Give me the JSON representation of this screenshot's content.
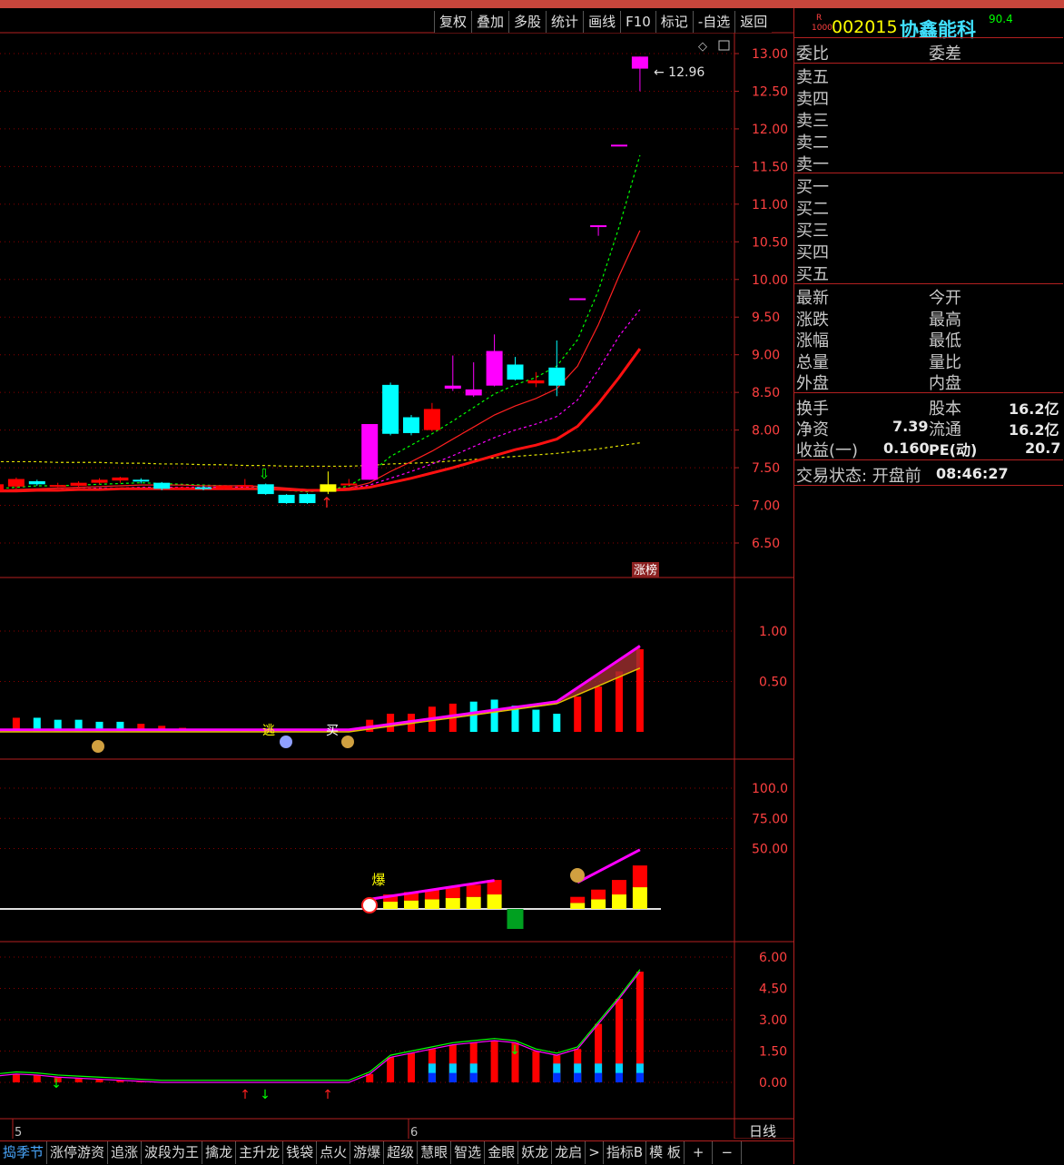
{
  "toolbar": [
    "复权",
    "叠加",
    "多股",
    "统计",
    "画线",
    "F10",
    "标记",
    "-自选",
    "返回"
  ],
  "stock": {
    "code": "002015",
    "name": "协鑫能科",
    "badge_top": "R",
    "badge_bottom": "1000",
    "score": "90.4"
  },
  "order_book": {
    "ratio_label": "委比",
    "diff_label": "委差",
    "sells": [
      "卖五",
      "卖四",
      "卖三",
      "卖二",
      "卖一"
    ],
    "buys": [
      "买一",
      "买二",
      "买三",
      "买四",
      "买五"
    ]
  },
  "stats_left": [
    "最新",
    "涨跌",
    "涨幅",
    "总量",
    "外盘"
  ],
  "stats_right": [
    "今开",
    "最高",
    "最低",
    "量比",
    "内盘"
  ],
  "fundamentals": [
    {
      "label": "换手",
      "label2": "股本",
      "value2": "16.2亿"
    },
    {
      "label": "净资",
      "value": "7.39",
      "label2": "流通",
      "value2": "16.2亿"
    },
    {
      "label": "收益(一)",
      "value": "0.160",
      "label2": "PE(动)",
      "value2": "20.7"
    }
  ],
  "trade_state": {
    "label": "交易状态: 开盘前",
    "time": "08:46:27"
  },
  "price_axis": [
    "13.00",
    "12.50",
    "12.00",
    "11.50",
    "11.00",
    "10.50",
    "10.00",
    "9.50",
    "9.00",
    "8.50",
    "8.00",
    "7.50",
    "7.00",
    "6.50"
  ],
  "price_max_label": "12.96",
  "zhangbang": "涨榜",
  "ind1_axis": [
    "1.00",
    "0.50"
  ],
  "ind2_axis": [
    "100.0",
    "75.00",
    "50.00"
  ],
  "ind3_axis": [
    "6.00",
    "4.50",
    "3.00",
    "1.50",
    "0.00"
  ],
  "markers": {
    "escape": "逃",
    "buy": "买",
    "explode": "爆"
  },
  "date_labels": [
    "5",
    "6"
  ],
  "period": "日线",
  "bottom_tabs": [
    "捣季节",
    "涨停游资",
    "追涨",
    "波段为王",
    "擒龙",
    "主升龙",
    "钱袋",
    "点火",
    "游爆",
    "超级",
    "慧眼",
    "智选",
    "金眼",
    "妖龙",
    "龙启",
    ">",
    "指标B",
    "模 板",
    "+",
    "−"
  ],
  "colors": {
    "up": "#ff0000",
    "down": "#00ffff",
    "magenta": "#ff00ff",
    "grid": "#8b0000",
    "border": "#b32020",
    "yellow": "#ffff00",
    "green": "#00ff00"
  },
  "chart_data": {
    "type": "candlestick",
    "candles": [
      {
        "o": 7.2,
        "c": 7.28,
        "h": 7.3,
        "l": 7.18
      },
      {
        "o": 7.25,
        "c": 7.35,
        "h": 7.37,
        "l": 7.22
      },
      {
        "o": 7.32,
        "c": 7.28,
        "h": 7.34,
        "l": 7.26
      },
      {
        "o": 7.27,
        "c": 7.27,
        "h": 7.3,
        "l": 7.24
      },
      {
        "o": 7.26,
        "c": 7.3,
        "h": 7.32,
        "l": 7.24
      },
      {
        "o": 7.3,
        "c": 7.34,
        "h": 7.36,
        "l": 7.28
      },
      {
        "o": 7.33,
        "c": 7.37,
        "h": 7.38,
        "l": 7.3
      },
      {
        "o": 7.34,
        "c": 7.32,
        "h": 7.36,
        "l": 7.29
      },
      {
        "o": 7.3,
        "c": 7.22,
        "h": 7.31,
        "l": 7.2
      },
      {
        "o": 7.22,
        "c": 7.24,
        "h": 7.25,
        "l": 7.2
      },
      {
        "o": 7.24,
        "c": 7.22,
        "h": 7.26,
        "l": 7.2
      },
      {
        "o": 7.22,
        "c": 7.26,
        "h": 7.27,
        "l": 7.21
      },
      {
        "o": 7.25,
        "c": 7.27,
        "h": 7.35,
        "l": 7.22
      },
      {
        "o": 7.28,
        "c": 7.15,
        "h": 7.29,
        "l": 7.14
      },
      {
        "o": 7.14,
        "c": 7.03,
        "h": 7.15,
        "l": 7.02
      },
      {
        "o": 7.15,
        "c": 7.03,
        "h": 7.16,
        "l": 7.02
      },
      {
        "o": 7.18,
        "c": 7.28,
        "h": 7.45,
        "l": 7.15
      },
      {
        "o": 7.29,
        "c": 7.29,
        "h": 7.35,
        "l": 7.27
      },
      {
        "o": 7.34,
        "c": 8.08,
        "h": 8.08,
        "l": 7.34
      },
      {
        "o": 8.6,
        "c": 7.95,
        "h": 8.63,
        "l": 7.93
      },
      {
        "o": 8.17,
        "c": 7.96,
        "h": 8.2,
        "l": 7.93
      },
      {
        "o": 8.0,
        "c": 8.28,
        "h": 8.36,
        "l": 7.98
      },
      {
        "o": 8.55,
        "c": 8.59,
        "h": 8.99,
        "l": 8.52
      },
      {
        "o": 8.46,
        "c": 8.54,
        "h": 8.9,
        "l": 8.44
      },
      {
        "o": 8.59,
        "c": 9.05,
        "h": 9.27,
        "l": 8.58
      },
      {
        "o": 8.87,
        "c": 8.67,
        "h": 8.97,
        "l": 8.66
      },
      {
        "o": 8.62,
        "c": 8.66,
        "h": 8.77,
        "l": 8.57
      },
      {
        "o": 8.83,
        "c": 8.59,
        "h": 9.19,
        "l": 8.45
      },
      {
        "o": 9.75,
        "c": 9.75,
        "h": 9.75,
        "l": 9.75
      },
      {
        "o": 10.72,
        "c": 10.72,
        "h": 10.72,
        "l": 10.58
      },
      {
        "o": 11.79,
        "c": 11.79,
        "h": 11.79,
        "l": 11.79
      },
      {
        "o": 12.96,
        "c": 12.8,
        "h": 12.96,
        "l": 12.5
      }
    ],
    "ma_dashed_green": [
      7.22,
      7.24,
      7.26,
      7.26,
      7.27,
      7.28,
      7.29,
      7.3,
      7.29,
      7.28,
      7.27,
      7.26,
      7.26,
      7.24,
      7.2,
      7.18,
      7.2,
      7.26,
      7.42,
      7.65,
      7.8,
      7.95,
      8.12,
      8.3,
      8.48,
      8.6,
      8.7,
      8.85,
      9.2,
      9.85,
      10.7,
      11.65
    ],
    "ma_red": [
      7.2,
      7.21,
      7.22,
      7.23,
      7.24,
      7.25,
      7.26,
      7.27,
      7.27,
      7.27,
      7.26,
      7.26,
      7.26,
      7.25,
      7.23,
      7.21,
      7.21,
      7.23,
      7.3,
      7.45,
      7.58,
      7.72,
      7.88,
      8.04,
      8.2,
      8.32,
      8.42,
      8.55,
      8.85,
      9.4,
      10.05,
      10.65
    ],
    "ma_dashed_magenta": [
      7.2,
      7.2,
      7.21,
      7.21,
      7.22,
      7.23,
      7.23,
      7.24,
      7.24,
      7.24,
      7.24,
      7.24,
      7.24,
      7.23,
      7.22,
      7.21,
      7.21,
      7.22,
      7.27,
      7.36,
      7.45,
      7.55,
      7.66,
      7.78,
      7.9,
      8.0,
      8.08,
      8.18,
      8.4,
      8.8,
      9.25,
      9.6
    ],
    "ma_thick": [
      7.19,
      7.19,
      7.2,
      7.2,
      7.21,
      7.21,
      7.22,
      7.22,
      7.22,
      7.22,
      7.22,
      7.22,
      7.22,
      7.22,
      7.21,
      7.2,
      7.2,
      7.21,
      7.24,
      7.3,
      7.36,
      7.43,
      7.5,
      7.58,
      7.66,
      7.74,
      7.8,
      7.88,
      8.05,
      8.35,
      8.7,
      9.08
    ],
    "ma_yellow_dashed": [
      7.58,
      7.58,
      7.58,
      7.57,
      7.57,
      7.57,
      7.56,
      7.56,
      7.55,
      7.55,
      7.54,
      7.54,
      7.53,
      7.53,
      7.52,
      7.52,
      7.52,
      7.52,
      7.53,
      7.55,
      7.56,
      7.57,
      7.59,
      7.61,
      7.63,
      7.65,
      7.67,
      7.69,
      7.72,
      7.75,
      7.79,
      7.83
    ],
    "ind1_bars": [
      0.1,
      0.14,
      0.14,
      0.12,
      0.12,
      0.1,
      0.1,
      0.08,
      0.06,
      0.04,
      0.03,
      0.03,
      0.02,
      0.02,
      0.02,
      0.02,
      0.03,
      0.03,
      0.12,
      0.18,
      0.18,
      0.25,
      0.28,
      0.3,
      0.32,
      0.26,
      0.22,
      0.18,
      0.35,
      0.45,
      0.6,
      0.82
    ],
    "ind3_bars": [
      0.3,
      0.4,
      0.35,
      0.25,
      0.2,
      0.15,
      0.1,
      0.05,
      0,
      0,
      0,
      0,
      0,
      0,
      0,
      0,
      0,
      0,
      0.4,
      1.2,
      1.4,
      1.6,
      1.8,
      1.9,
      2.0,
      1.9,
      1.5,
      1.3,
      1.6,
      2.8,
      4.0,
      5.3,
      5.8
    ]
  }
}
